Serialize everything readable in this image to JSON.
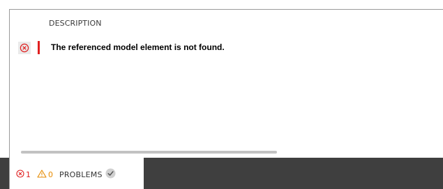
{
  "problems_panel": {
    "column_header": "DESCRIPTION",
    "rows": [
      {
        "severity_icon": "error-circle-x-icon",
        "text": "The referenced model element is not found.",
        "severity_color": "#e02020"
      }
    ]
  },
  "status_tab": {
    "error_count": "1",
    "warning_count": "0",
    "label": "PROBLEMS",
    "status_icon": "check-circle-icon"
  },
  "colors": {
    "error": "#e02020",
    "warning": "#e68a00",
    "bottom_bar": "#3f3f3f",
    "scrollbar": "#c2c2c2"
  }
}
